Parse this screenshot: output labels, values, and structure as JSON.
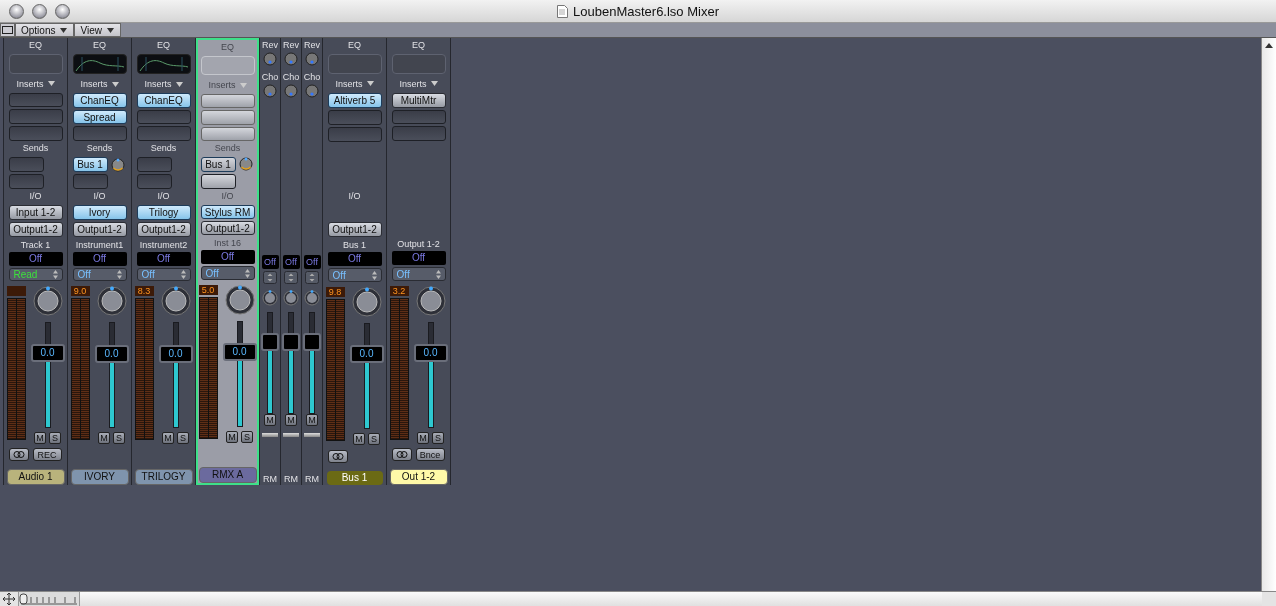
{
  "window": {
    "title": "LoubenMaster6.lso Mixer"
  },
  "menus": [
    {
      "label": "Options"
    },
    {
      "label": "View"
    }
  ],
  "zoom_slider": {
    "level": 0.0
  },
  "strips": [
    {
      "kind": "full",
      "selected": false,
      "eq_label": "EQ",
      "eq_curve": false,
      "inserts_label": "Inserts",
      "sends_label": "Sends",
      "io_label": "I/O",
      "input": {
        "label": "Input 1-2",
        "active": false
      },
      "output": "Output1-2",
      "track": "Track 1",
      "group": "Off",
      "automation": {
        "label": "Read",
        "active": true
      },
      "fader_value": "0.0",
      "level": 0.7,
      "mute": "M",
      "solo": "S",
      "link": true,
      "extra_button": "REC",
      "name": "Audio 1",
      "color": "#b9b37c"
    },
    {
      "kind": "full",
      "selected": false,
      "eq_label": "EQ",
      "eq_curve": true,
      "inserts_label": "Inserts",
      "inserts": [
        {
          "label": "ChanEQ",
          "active": true
        },
        {
          "label": "Spread",
          "active": true
        }
      ],
      "sends_label": "Sends",
      "sends": [
        {
          "label": "Bus 1"
        }
      ],
      "io_label": "I/O",
      "input": {
        "label": "Ivory",
        "active": true
      },
      "output": "Output1-2",
      "track": "Instrument1",
      "group": "Off",
      "automation": {
        "label": "Off",
        "active": false
      },
      "peak": "9.0",
      "fader_value": "0.0",
      "level": 0.7,
      "mute": "M",
      "solo": "S",
      "link": false,
      "name": "IVORY",
      "color": "#7f94ad"
    },
    {
      "kind": "full",
      "selected": false,
      "eq_label": "EQ",
      "eq_curve": true,
      "inserts_label": "Inserts",
      "inserts": [
        {
          "label": "ChanEQ",
          "active": true
        }
      ],
      "sends_label": "Sends",
      "io_label": "I/O",
      "input": {
        "label": "Trilogy",
        "active": true
      },
      "output": "Output1-2",
      "track": "Instrument2",
      "group": "Off",
      "automation": {
        "label": "Off",
        "active": false
      },
      "peak": "8.3",
      "fader_value": "0.0",
      "level": 0.7,
      "mute": "M",
      "solo": "S",
      "link": false,
      "name": "TRILOGY",
      "color": "#7f94ad"
    },
    {
      "kind": "full",
      "selected": true,
      "eq_label": "EQ",
      "eq_curve": false,
      "inserts_label": "Inserts",
      "sends_label": "Sends",
      "sends": [
        {
          "label": "Bus 1"
        }
      ],
      "io_label": "I/O",
      "input": {
        "label": "Stylus RM",
        "active": true
      },
      "output": "Output1-2",
      "track": "Inst 16",
      "group": "Off",
      "automation": {
        "label": "Off",
        "active": false
      },
      "peak": "5.0",
      "fader_value": "0.0",
      "level": 0.7,
      "mute": "M",
      "solo": "S",
      "link": false,
      "name": "RMX A",
      "color": "#6b6a9e"
    },
    {
      "kind": "aux",
      "sends": [
        {
          "label": "Rev"
        },
        {
          "label": "Cho"
        }
      ],
      "group": "Off",
      "level": 0.7,
      "mute": "M",
      "name": "RM"
    },
    {
      "kind": "aux",
      "sends": [
        {
          "label": "Rev"
        },
        {
          "label": "Cho"
        }
      ],
      "group": "Off",
      "level": 0.7,
      "mute": "M",
      "name": "RM"
    },
    {
      "kind": "aux",
      "sends": [
        {
          "label": "Rev"
        },
        {
          "label": "Cho"
        }
      ],
      "group": "Off",
      "level": 0.7,
      "mute": "M",
      "name": "RM"
    },
    {
      "kind": "full",
      "selected": false,
      "eq_label": "EQ",
      "eq_curve": false,
      "inserts_label": "Inserts",
      "inserts": [
        {
          "label": "Altiverb 5",
          "active": true
        }
      ],
      "io_label": "I/O",
      "output": "Output1-2",
      "track": "Bus 1",
      "group": "Off",
      "automation": {
        "label": "Off",
        "active": false
      },
      "peak": "9.8",
      "fader_value": "0.0",
      "level": 0.7,
      "mute": "M",
      "solo": "S",
      "link": true,
      "name": "Bus 1",
      "color": "#6b6a14"
    },
    {
      "kind": "full",
      "selected": false,
      "eq_label": "EQ",
      "eq_curve": false,
      "inserts_label": "Inserts",
      "inserts": [
        {
          "label": "MultiMtr",
          "active": false
        }
      ],
      "track": "Output 1-2",
      "group": "Off",
      "automation": {
        "label": "Off",
        "active": false
      },
      "peak": "3.2",
      "fader_value": "0.0",
      "level": 0.7,
      "mute": "M",
      "solo": "S",
      "link": true,
      "extra_button": "Bnce",
      "name": "Out 1-2",
      "color": "#fff9a8"
    }
  ]
}
